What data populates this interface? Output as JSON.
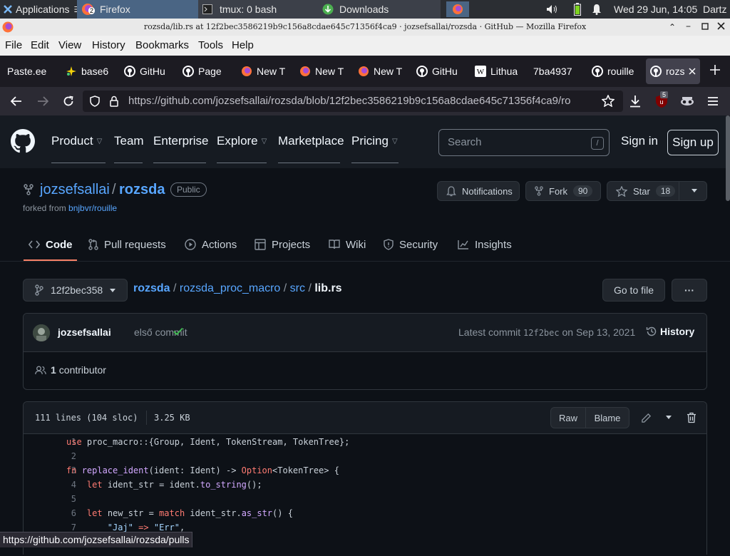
{
  "desktop_panel": {
    "applications_label": "Applications",
    "taskbar": [
      {
        "label": "Firefox",
        "badge": "2",
        "active": true
      },
      {
        "label": "tmux: 0 bash"
      },
      {
        "label": "Downloads"
      }
    ],
    "clock": "Wed 29 Jun, 14:05",
    "user": "Dartz"
  },
  "window": {
    "title": "rozsda/lib.rs at 12f2bec3586219b9c156a8cdae645c71356f4ca9 · jozsefsallai/rozsda · GitHub — Mozilla Firefox"
  },
  "menubar": [
    "File",
    "Edit",
    "View",
    "History",
    "Bookmarks",
    "Tools",
    "Help"
  ],
  "tabs": [
    {
      "label": "Paste.ee",
      "icon": "none"
    },
    {
      "label": "base6",
      "icon": "sparkle-icon"
    },
    {
      "label": "GitHu",
      "icon": "github-icon"
    },
    {
      "label": "Page",
      "icon": "github-icon"
    },
    {
      "label": "New T",
      "icon": "firefox-icon"
    },
    {
      "label": "New T",
      "icon": "firefox-icon"
    },
    {
      "label": "New T",
      "icon": "firefox-icon"
    },
    {
      "label": "GitHu",
      "icon": "github-icon"
    },
    {
      "label": "Lithua",
      "icon": "wikipedia-icon"
    },
    {
      "label": "7ba4937",
      "icon": "none"
    },
    {
      "label": "rouille",
      "icon": "github-icon"
    },
    {
      "label": "rozs",
      "icon": "github-icon",
      "active": true
    }
  ],
  "navbar": {
    "url": "https://github.com/jozsefsallai/rozsda/blob/12f2bec3586219b9c156a8cdae645c71356f4ca9/ro",
    "extension_badge": "5"
  },
  "github_header": {
    "nav": [
      {
        "label": "Product",
        "dropdown": true
      },
      {
        "label": "Team",
        "dropdown": false
      },
      {
        "label": "Enterprise",
        "dropdown": false
      },
      {
        "label": "Explore",
        "dropdown": true
      },
      {
        "label": "Marketplace",
        "dropdown": false
      },
      {
        "label": "Pricing",
        "dropdown": true
      }
    ],
    "search_placeholder": "Search",
    "search_shortcut": "/",
    "sign_in": "Sign in",
    "sign_up": "Sign up"
  },
  "repo": {
    "owner": "jozsefsallai",
    "separator": "/",
    "name": "rozsda",
    "visibility": "Public",
    "forked_from_label": "forked from",
    "forked_from": "bnjbvr/rouille",
    "notifications_label": "Notifications",
    "fork_label": "Fork",
    "fork_count": "90",
    "star_label": "Star",
    "star_count": "18",
    "tabs": [
      "Code",
      "Pull requests",
      "Actions",
      "Projects",
      "Wiki",
      "Security",
      "Insights"
    ]
  },
  "file_nav": {
    "branch": "12f2bec358",
    "path": [
      "rozsda",
      "rozsda_proc_macro",
      "src"
    ],
    "file": "lib.rs",
    "go_to_file": "Go to file",
    "more": "···"
  },
  "commit": {
    "author": "jozsefsallai",
    "message": "első commit",
    "latest_label": "Latest commit",
    "sha": "12f2bec",
    "date": "on Sep 13, 2021",
    "history_label": "History",
    "contributors_count": "1",
    "contributors_label": "contributor"
  },
  "file_header": {
    "lines": "111 lines (104 sloc)",
    "size": "3.25 KB",
    "raw": "Raw",
    "blame": "Blame"
  },
  "code_lines": [
    {
      "n": "1",
      "text": "use proc_macro::{Group, Ident, TokenStream, TokenTree};"
    },
    {
      "n": "2",
      "text": ""
    },
    {
      "n": "3",
      "text": "fn replace_ident(ident: Ident) -> Option<TokenTree> {"
    },
    {
      "n": "4",
      "text": "    let ident_str = ident.to_string();"
    },
    {
      "n": "5",
      "text": ""
    },
    {
      "n": "6",
      "text": "    let new_str = match ident_str.as_str() {"
    },
    {
      "n": "7",
      "text": "        \"Jaj\" => \"Err\","
    }
  ],
  "status_bar": "https://github.com/jozsefsallai/rozsda/pulls"
}
